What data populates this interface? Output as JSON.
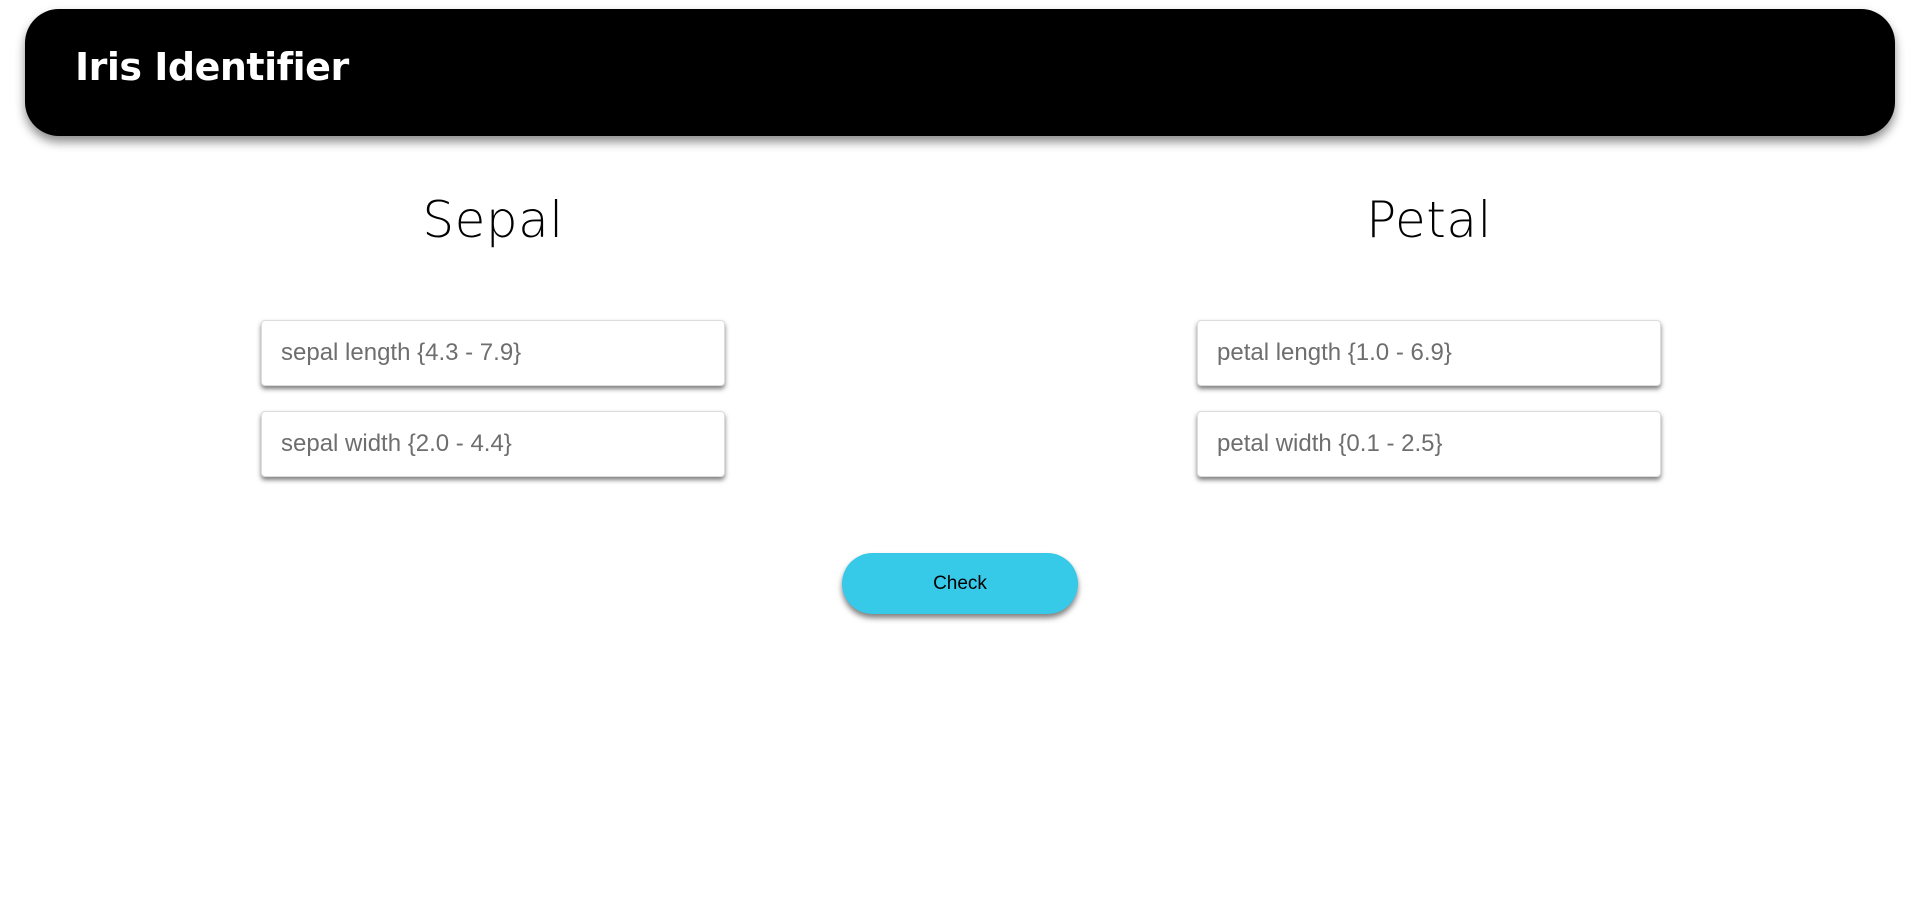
{
  "header": {
    "title": "Iris Identifier",
    "background_color": "#000000"
  },
  "sepal": {
    "heading": "Sepal",
    "length_placeholder": "sepal length {4.3 - 7.9}",
    "width_placeholder": "sepal width {2.0 - 4.4}"
  },
  "petal": {
    "heading": "Petal",
    "length_placeholder": "petal length {1.0 - 6.9}",
    "width_placeholder": "petal width {0.1 - 2.5}"
  },
  "actions": {
    "check_label": "Check",
    "check_color": "#36c9e8"
  }
}
